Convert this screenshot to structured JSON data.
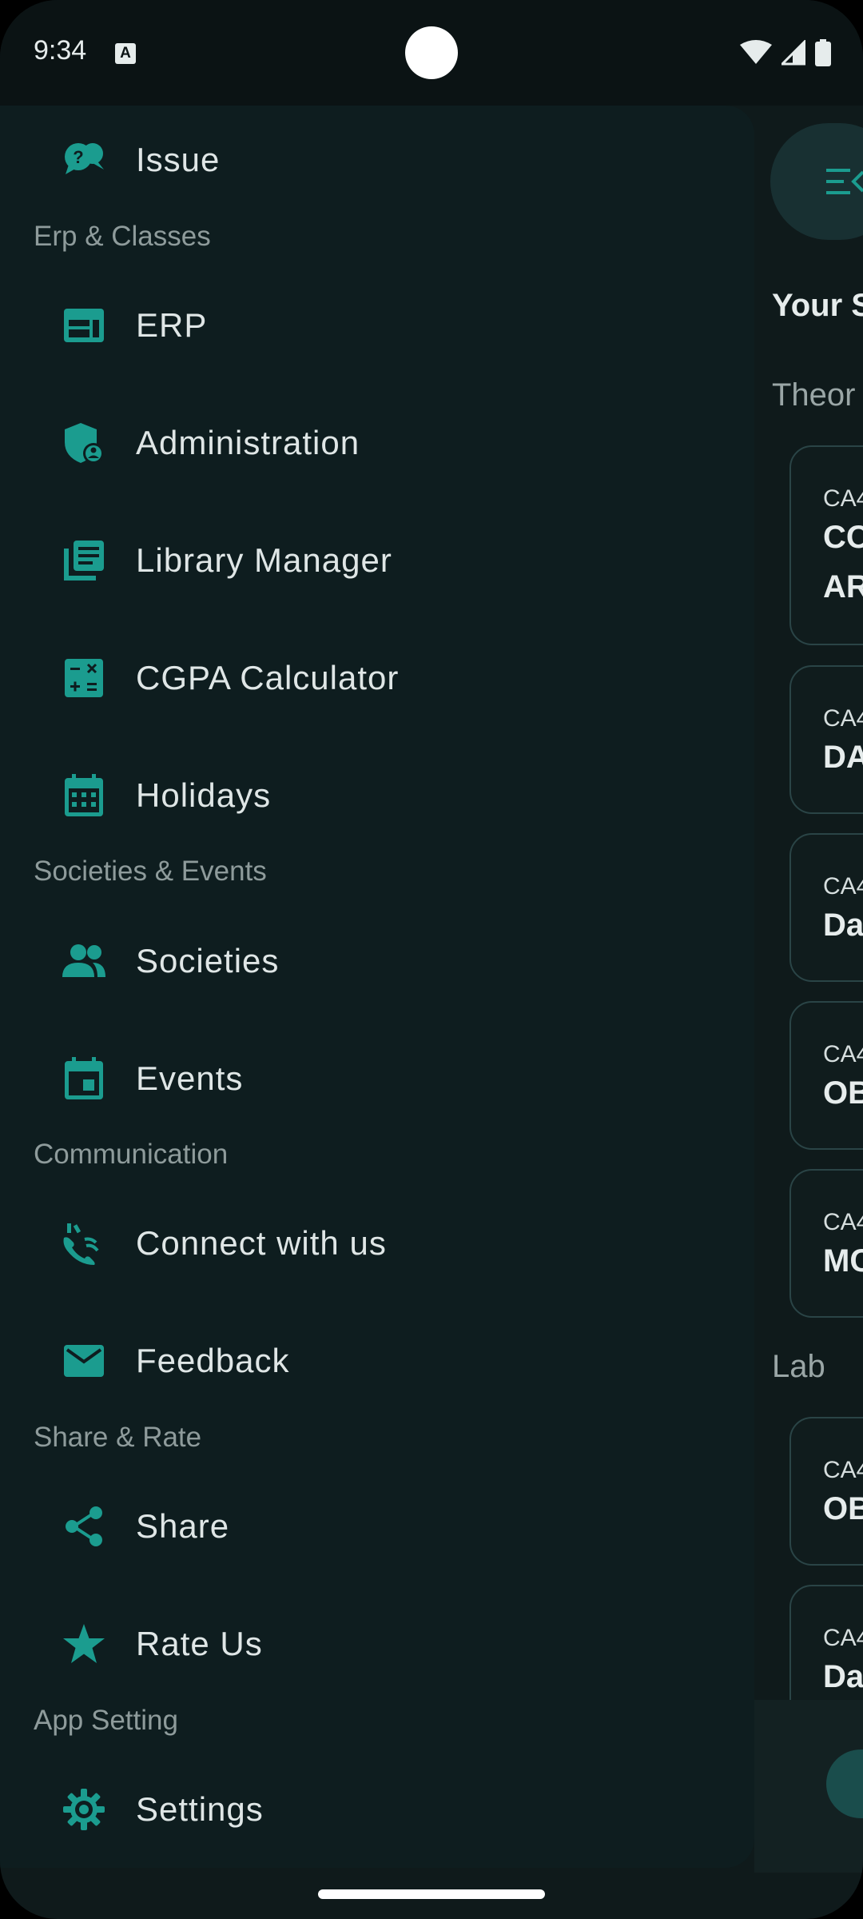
{
  "status_bar": {
    "time": "9:34",
    "notification_icon": "A",
    "icons": [
      "wifi-icon",
      "signal-icon",
      "battery-icon"
    ]
  },
  "colors": {
    "accent": "#1b9c8f",
    "drawer_bg": "#0e1d1f",
    "text": "#dfe6e6",
    "section_text": "#8e9b9b"
  },
  "drawer": {
    "items": [
      {
        "label": "Issue",
        "icon": "issue-chat-icon"
      },
      {
        "section": "Erp & Classes"
      },
      {
        "label": "ERP",
        "icon": "erp-window-icon"
      },
      {
        "label": "Administration",
        "icon": "admin-shield-icon"
      },
      {
        "label": "Library Manager",
        "icon": "library-icon"
      },
      {
        "label": "CGPA Calculator",
        "icon": "calculator-icon"
      },
      {
        "label": "Holidays",
        "icon": "calendar-grid-icon"
      },
      {
        "section": "Societies & Events"
      },
      {
        "label": "Societies",
        "icon": "people-icon"
      },
      {
        "label": "Events",
        "icon": "event-icon"
      },
      {
        "section": "Communication"
      },
      {
        "label": "Connect with us",
        "icon": "connect-icon"
      },
      {
        "label": "Feedback",
        "icon": "mail-icon"
      },
      {
        "section": "Share & Rate"
      },
      {
        "label": "Share",
        "icon": "share-icon"
      },
      {
        "label": "Rate Us",
        "icon": "star-icon"
      },
      {
        "section": "App Setting"
      },
      {
        "label": "Settings",
        "icon": "gear-icon"
      }
    ]
  },
  "main": {
    "menu_icon": "menu-collapse-icon",
    "heading": "Your S",
    "theory_label": "Theor",
    "lab_label": "Lab",
    "theory_cards": [
      {
        "code": "CA4",
        "name": [
          "CO",
          "AR"
        ]
      },
      {
        "code": "CA4",
        "name": [
          "DA"
        ]
      },
      {
        "code": "CA4",
        "name": [
          "Da"
        ]
      },
      {
        "code": "CA4",
        "name": [
          "OB"
        ]
      },
      {
        "code": "CA4",
        "name": [
          "MC"
        ]
      }
    ],
    "lab_cards": [
      {
        "code": "CA4",
        "name": [
          "OB"
        ]
      },
      {
        "code": "CA4",
        "name": [
          "Da"
        ]
      }
    ]
  }
}
